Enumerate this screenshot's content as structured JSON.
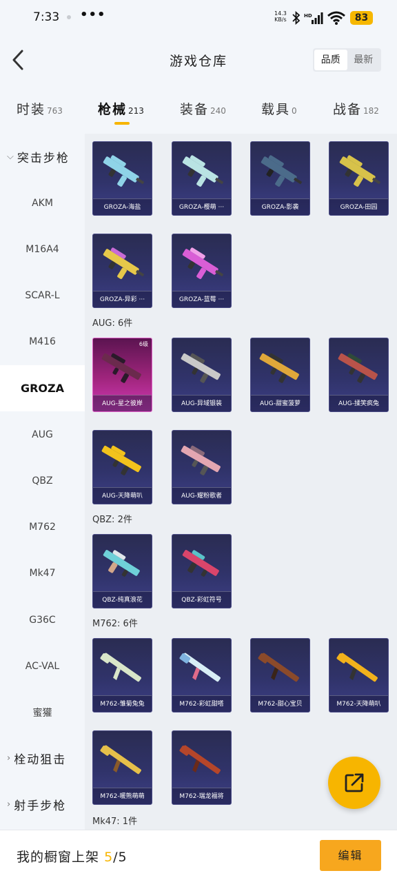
{
  "status_bar": {
    "time": "7:33",
    "more": "•••",
    "net_speed_value": "14.3",
    "net_speed_unit": "KB/s",
    "battery": "83"
  },
  "header": {
    "title": "游戏仓库",
    "sort_options": [
      "品质",
      "最新"
    ]
  },
  "tabs": [
    {
      "label": "时装",
      "count": "763"
    },
    {
      "label": "枪械",
      "count": "213",
      "active": true
    },
    {
      "label": "装备",
      "count": "240"
    },
    {
      "label": "载具",
      "count": "0"
    },
    {
      "label": "战备",
      "count": "182"
    }
  ],
  "sidebar": {
    "groups": [
      {
        "label": "突击步枪",
        "expanded": true
      },
      {
        "label": "栓动狙击",
        "expanded": false
      },
      {
        "label": "射手步枪",
        "expanded": false
      }
    ],
    "items": [
      "AKM",
      "M16A4",
      "SCAR-L",
      "M416",
      "GROZA",
      "AUG",
      "QBZ",
      "M762",
      "Mk47",
      "G36C",
      "AC-VAL",
      "蜜獾"
    ],
    "active_item": "GROZA"
  },
  "sections": [
    {
      "title": "",
      "cards": [
        {
          "label": "GROZA-海盐",
          "color": "#8fd3e8"
        },
        {
          "label": "GROZA-樱萌 ···",
          "color": "#b9e3e3"
        },
        {
          "label": "GROZA-影袭",
          "color": "#4b6b8a"
        },
        {
          "label": "GROZA-田园",
          "color": "#d7c24a"
        },
        {
          "label": "GROZA-异彩 ···",
          "color": "#e6c84a"
        },
        {
          "label": "GROZA-蓝莓 ···",
          "color": "#d95ed6"
        }
      ]
    },
    {
      "title": "AUG: 6件",
      "cards": [
        {
          "label": "AUG-星之彼岸",
          "color": "#6b2a4d",
          "level": "6级",
          "highlight": true
        },
        {
          "label": "AUG-异域银装",
          "color": "#c9c9c9"
        },
        {
          "label": "AUG-甜蜜菠萝",
          "color": "#e0a73a"
        },
        {
          "label": "AUG-揉笑疯兔",
          "color": "#b9534a"
        },
        {
          "label": "AUG-天降萌叭",
          "color": "#f2c21c"
        },
        {
          "label": "AUG-耀粉歌者",
          "color": "#e3a6b1"
        }
      ]
    },
    {
      "title": "QBZ: 2件",
      "cards": [
        {
          "label": "QBZ-纯真浪花",
          "color": "#6fd0d8"
        },
        {
          "label": "QBZ-彩虹符号",
          "color": "#d9456b"
        }
      ]
    },
    {
      "title": "M762: 6件",
      "cards": [
        {
          "label": "M762-雏菊兔兔",
          "color": "#d9e6c9"
        },
        {
          "label": "M762-彩虹甜嗒",
          "color": "#d8eef5"
        },
        {
          "label": "M762-甜心宝贝",
          "color": "#8b4a2a"
        },
        {
          "label": "M762-天降萌叭",
          "color": "#f2b21c"
        },
        {
          "label": "M762-暖熊萌萌",
          "color": "#e6c04a"
        },
        {
          "label": "M762-瑞龙福将",
          "color": "#b5462a"
        }
      ]
    },
    {
      "title": "Mk47: 1件",
      "cards": []
    }
  ],
  "bottom_bar": {
    "label": "我的橱窗上架",
    "count_used": "5",
    "count_total": "/5",
    "edit_label": "编辑"
  },
  "colors": {
    "accent": "#f7b500",
    "edit_button": "#f7a71e",
    "card_bg": "#2f3266",
    "card_highlight": "#c2309f"
  },
  "icons": {
    "back": "chevron-left-icon",
    "share": "external-link-icon",
    "bluetooth": "bluetooth-icon",
    "signal": "signal-bars-icon",
    "wifi": "wifi-icon"
  }
}
